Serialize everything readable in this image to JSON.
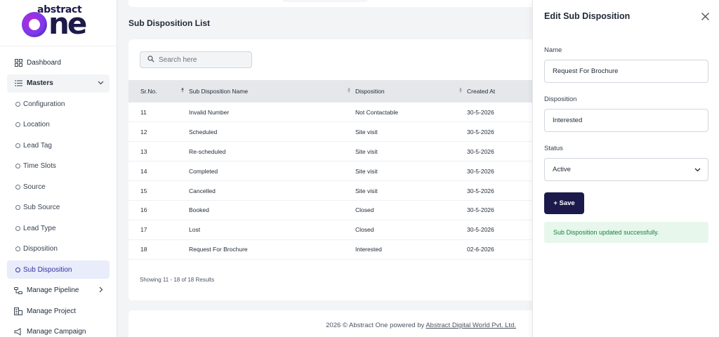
{
  "brand": {
    "small": "abstract",
    "big": "ne"
  },
  "sidebar": {
    "items": [
      {
        "label": "Dashboard"
      },
      {
        "label": "Masters"
      },
      {
        "label": "Configuration"
      },
      {
        "label": "Location"
      },
      {
        "label": "Lead Tag"
      },
      {
        "label": "Time Slots"
      },
      {
        "label": "Source"
      },
      {
        "label": "Sub Source"
      },
      {
        "label": "Lead Type"
      },
      {
        "label": "Disposition"
      },
      {
        "label": "Sub Disposition"
      },
      {
        "label": "Manage Pipeline"
      },
      {
        "label": "Manage Project"
      },
      {
        "label": "Manage Campaign"
      }
    ]
  },
  "main": {
    "title": "Sub Disposition List",
    "search_placeholder": "Search here",
    "columns": [
      "Sr.No.",
      "Sub Disposition Name",
      "Disposition",
      "Created At"
    ],
    "rows": [
      {
        "sr": "11",
        "name": "Invalid Number",
        "disposition": "Not Contactable",
        "created": "30-5-2026"
      },
      {
        "sr": "12",
        "name": "Scheduled",
        "disposition": "Site visit",
        "created": "30-5-2026"
      },
      {
        "sr": "13",
        "name": "Re-scheduled",
        "disposition": "Site visit",
        "created": "30-5-2026"
      },
      {
        "sr": "14",
        "name": "Completed",
        "disposition": "Site visit",
        "created": "30-5-2026"
      },
      {
        "sr": "15",
        "name": "Cancelled",
        "disposition": "Site visit",
        "created": "30-5-2026"
      },
      {
        "sr": "16",
        "name": "Booked",
        "disposition": "Closed",
        "created": "30-5-2026"
      },
      {
        "sr": "17",
        "name": "Lost",
        "disposition": "Closed",
        "created": "30-5-2026"
      },
      {
        "sr": "18",
        "name": "Request For Brochure",
        "disposition": "Interested",
        "created": "02-6-2026"
      }
    ],
    "showing": "Showing 11 - 18 of 18 Results"
  },
  "footer": {
    "prefix": "2026 © Abstract One powered by ",
    "link": "Abstract Digital World Pvt. Ltd."
  },
  "drawer": {
    "title": "Edit Sub Disposition",
    "name_label": "Name",
    "name_value": "Request For Brochure",
    "disposition_label": "Disposition",
    "disposition_value": "Interested",
    "status_label": "Status",
    "status_value": "Active",
    "save_label": "+ Save",
    "success_message": "Sub Disposition updated successfully."
  },
  "colors": {
    "brand": "#1c1a4a",
    "active_bg": "#e8ecfb",
    "success_bg": "#e7f7ec",
    "success_text": "#15803d"
  }
}
